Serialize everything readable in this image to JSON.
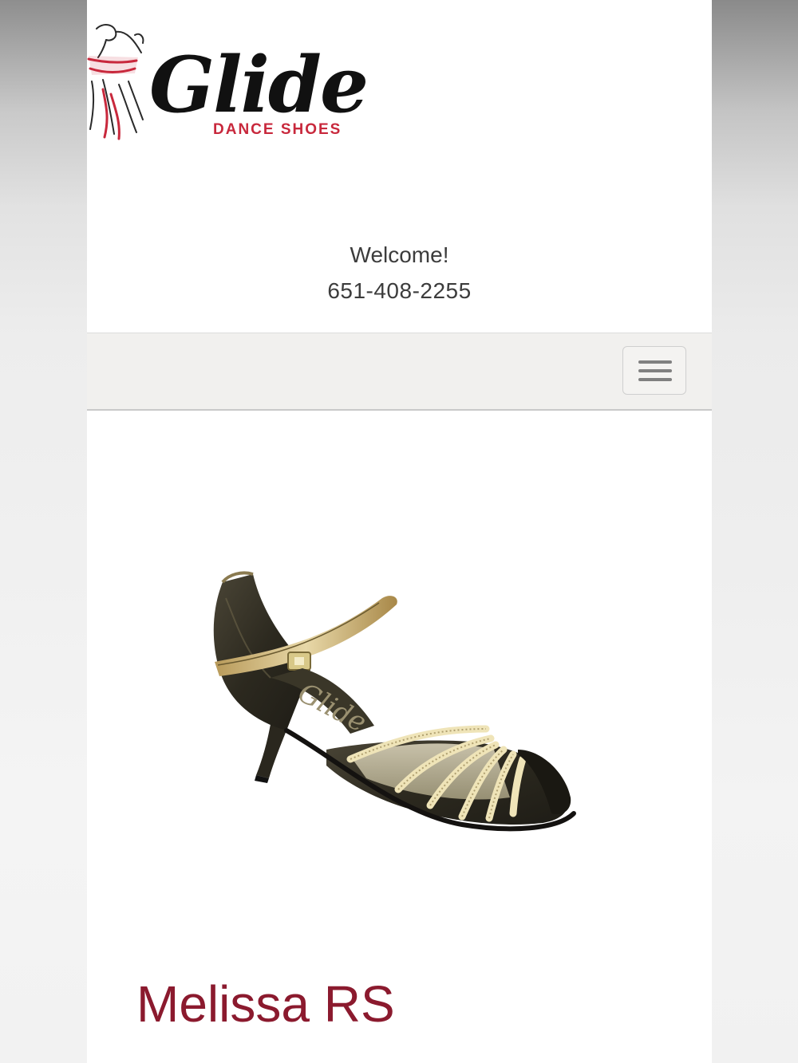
{
  "header": {
    "logo_wordmark": "Glide",
    "logo_subtitle": "DANCE SHOES",
    "welcome_text": "Welcome!",
    "phone": "651-408-2255"
  },
  "navbar": {
    "menu_icon": "hamburger-menu-icon"
  },
  "product": {
    "image_description_icon": "dance-shoe-image",
    "title": "Melissa RS"
  },
  "colors": {
    "brand_red": "#c8283c",
    "title_red": "#8b1a2e",
    "navbar_bg": "#f1f0ee",
    "text_dark": "#3c3c3c"
  }
}
